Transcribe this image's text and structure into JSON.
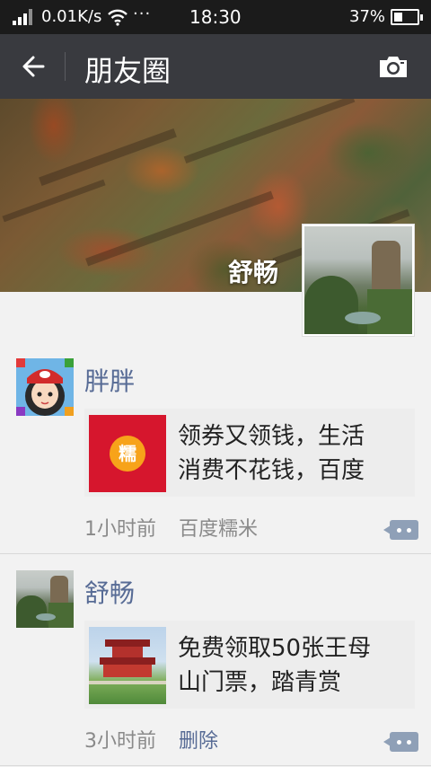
{
  "status_bar": {
    "speed": "0.01K/s",
    "dots": "···",
    "time": "18:30",
    "battery_percent": "37%",
    "battery_level": 0.37
  },
  "header": {
    "title": "朋友圈",
    "back_icon": "arrow-left-icon",
    "camera_icon": "camera-icon"
  },
  "profile": {
    "nickname": "舒畅"
  },
  "posts": [
    {
      "name": "胖胖",
      "share_text_line1": "领券又领钱，生活",
      "share_text_line2": "消费不花钱，百度",
      "thumb_glyph": "糯",
      "time": "1小时前",
      "source": "百度糯米"
    },
    {
      "name": "舒畅",
      "share_text_line1": "免费领取50张王母",
      "share_text_line2": "山门票，踏青赏",
      "time": "3小时前",
      "delete_label": "删除"
    }
  ],
  "colors": {
    "title_bar": "#393a3f",
    "link_blue": "#576b95",
    "red_packet": "#d9243a"
  }
}
